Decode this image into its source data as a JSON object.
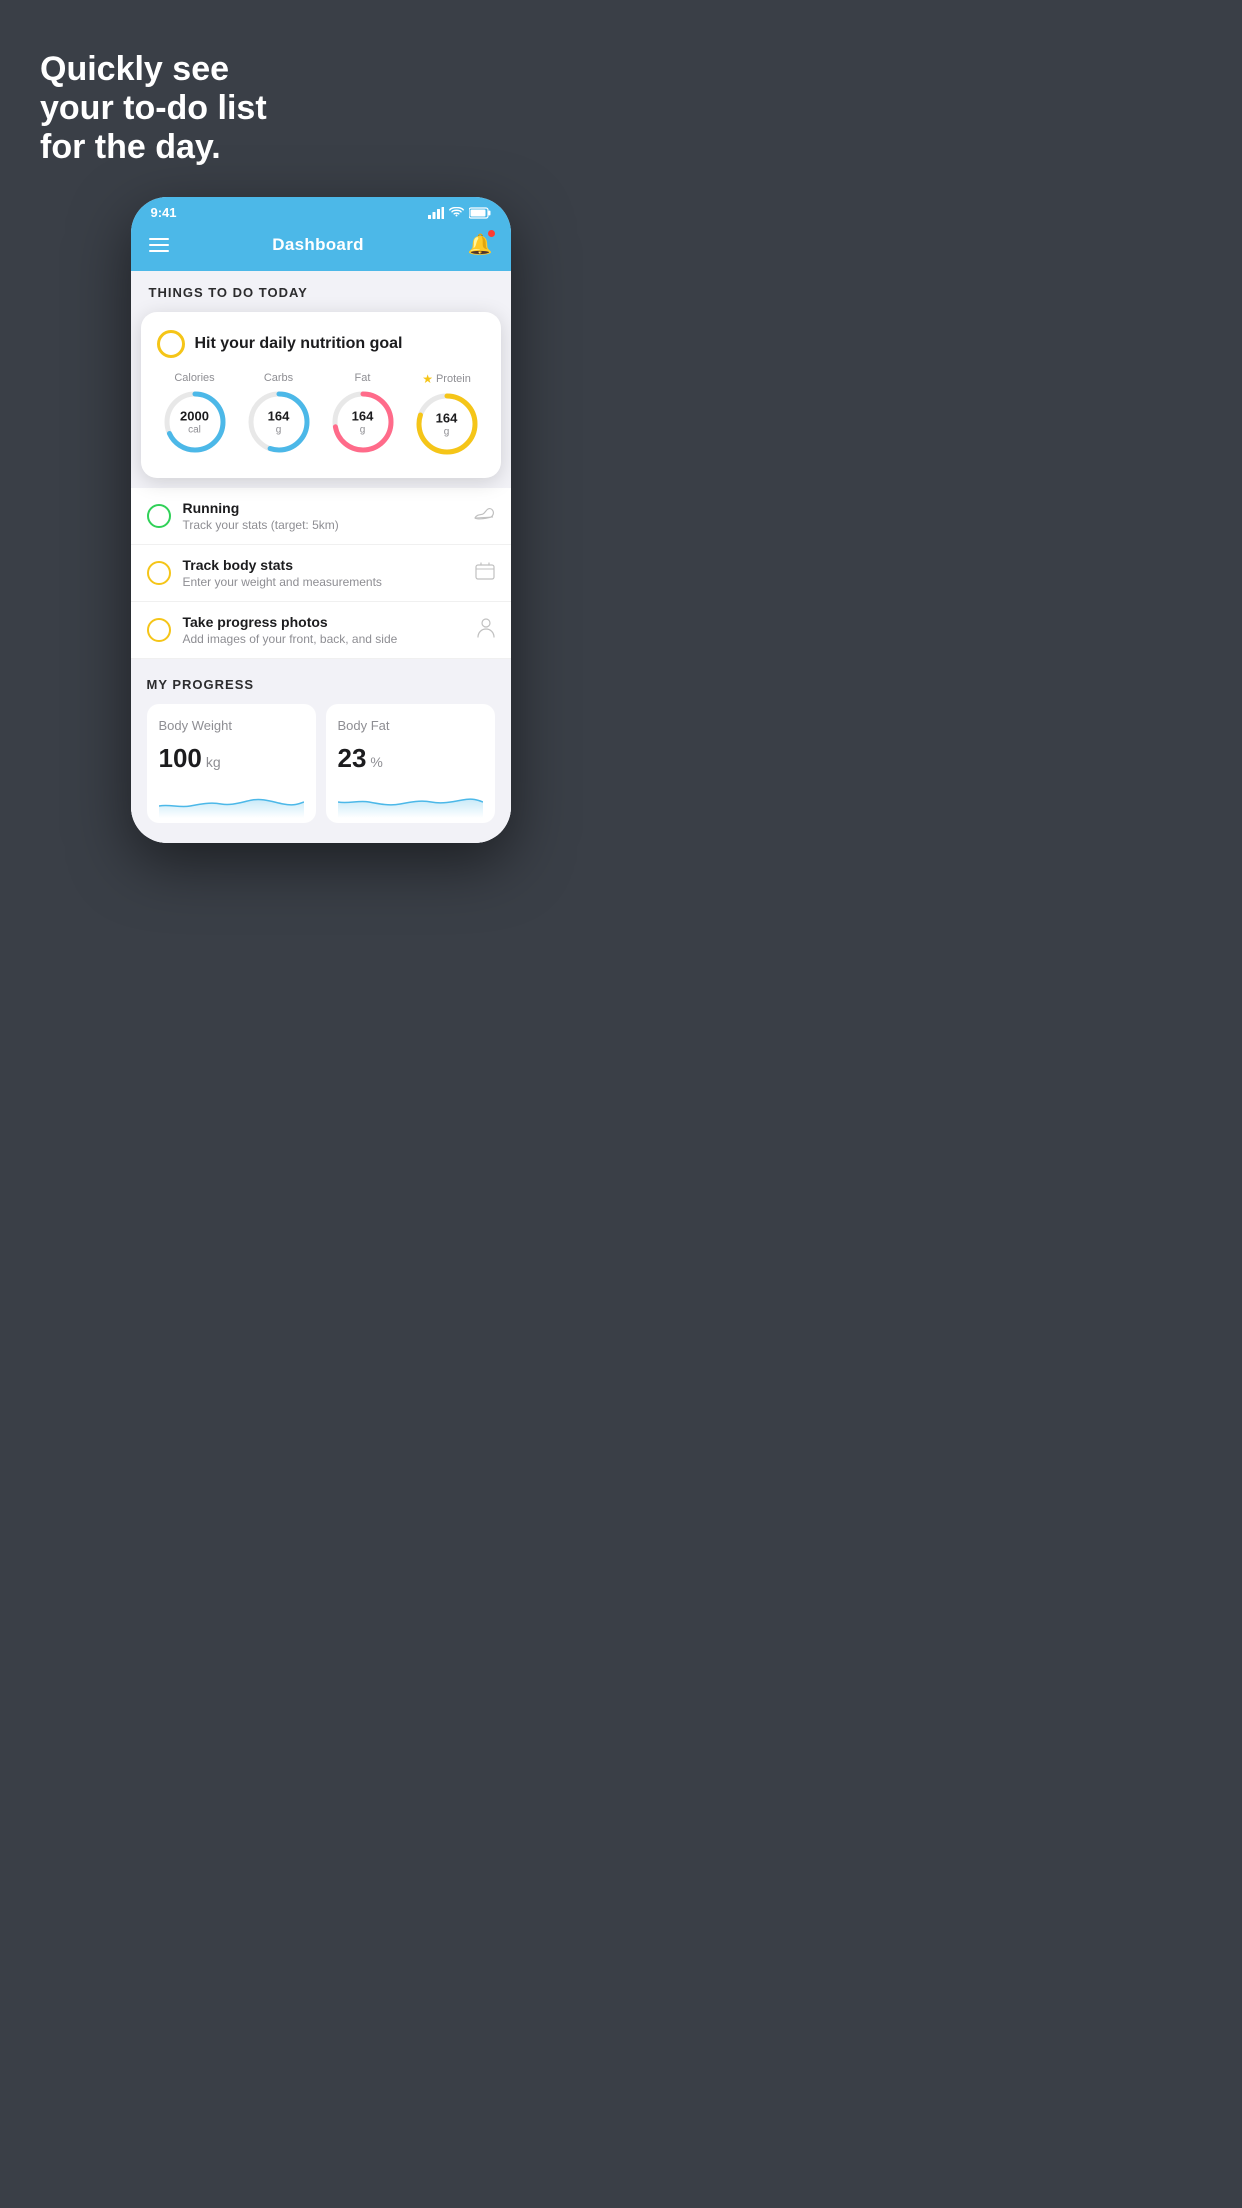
{
  "page": {
    "background_color": "#3a3f47",
    "headline": "Quickly see\nyour to-do list\nfor the day."
  },
  "status_bar": {
    "time": "9:41",
    "signal": "●●●●",
    "wifi": "wifi",
    "battery": "battery"
  },
  "nav": {
    "title": "Dashboard"
  },
  "things_section": {
    "label": "THINGS TO DO TODAY"
  },
  "nutrition_card": {
    "title": "Hit your daily nutrition goal",
    "items": [
      {
        "label": "Calories",
        "value": "2000",
        "unit": "cal",
        "color": "#4cb8e8",
        "percent": 68,
        "has_star": false
      },
      {
        "label": "Carbs",
        "value": "164",
        "unit": "g",
        "color": "#4cb8e8",
        "percent": 55,
        "has_star": false
      },
      {
        "label": "Fat",
        "value": "164",
        "unit": "g",
        "color": "#ff6b8a",
        "percent": 72,
        "has_star": false
      },
      {
        "label": "Protein",
        "value": "164",
        "unit": "g",
        "color": "#f5c518",
        "percent": 80,
        "has_star": true
      }
    ]
  },
  "todo_items": [
    {
      "name": "Running",
      "sub": "Track your stats (target: 5km)",
      "circle_color": "green",
      "icon": "shoe"
    },
    {
      "name": "Track body stats",
      "sub": "Enter your weight and measurements",
      "circle_color": "yellow",
      "icon": "scale"
    },
    {
      "name": "Take progress photos",
      "sub": "Add images of your front, back, and side",
      "circle_color": "yellow",
      "icon": "person"
    }
  ],
  "my_progress": {
    "label": "MY PROGRESS",
    "cards": [
      {
        "title": "Body Weight",
        "value": "100",
        "unit": "kg"
      },
      {
        "title": "Body Fat",
        "value": "23",
        "unit": "%"
      }
    ]
  }
}
